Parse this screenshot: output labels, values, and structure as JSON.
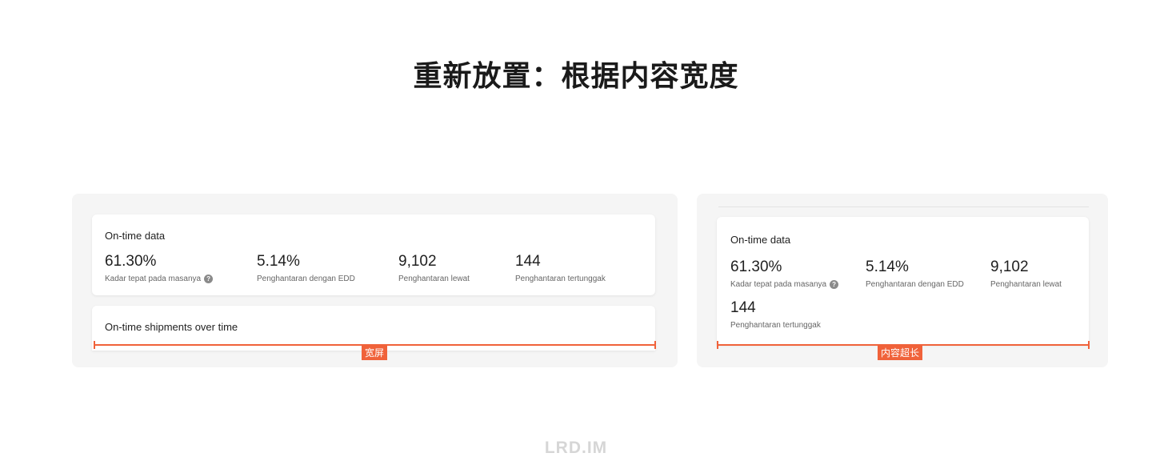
{
  "title": "重新放置：根据内容宽度",
  "left_panel": {
    "card1": {
      "title": "On-time data",
      "metrics": [
        {
          "value": "61.30%",
          "label": "Kadar tepat pada masanya",
          "help_icon": "?"
        },
        {
          "value": "5.14%",
          "label": "Penghantaran dengan EDD"
        },
        {
          "value": "9,102",
          "label": "Penghantaran lewat"
        },
        {
          "value": "144",
          "label": "Penghantaran tertunggak"
        }
      ]
    },
    "card2": {
      "title": "On-time shipments over time"
    },
    "ruler_label": "宽屏"
  },
  "right_panel": {
    "card1": {
      "title": "On-time data",
      "metrics": [
        {
          "value": "61.30%",
          "label": "Kadar tepat pada masanya",
          "help_icon": "?"
        },
        {
          "value": "5.14%",
          "label": "Penghantaran dengan EDD"
        },
        {
          "value": "9,102",
          "label": "Penghantaran lewat"
        },
        {
          "value": "144",
          "label": "Penghantaran tertunggak"
        }
      ]
    },
    "ruler_label": "内容超长"
  },
  "watermark": "LRD.IM",
  "colors": {
    "accent": "#f0623a",
    "panel_bg": "#f5f5f5",
    "card_bg": "#ffffff"
  }
}
